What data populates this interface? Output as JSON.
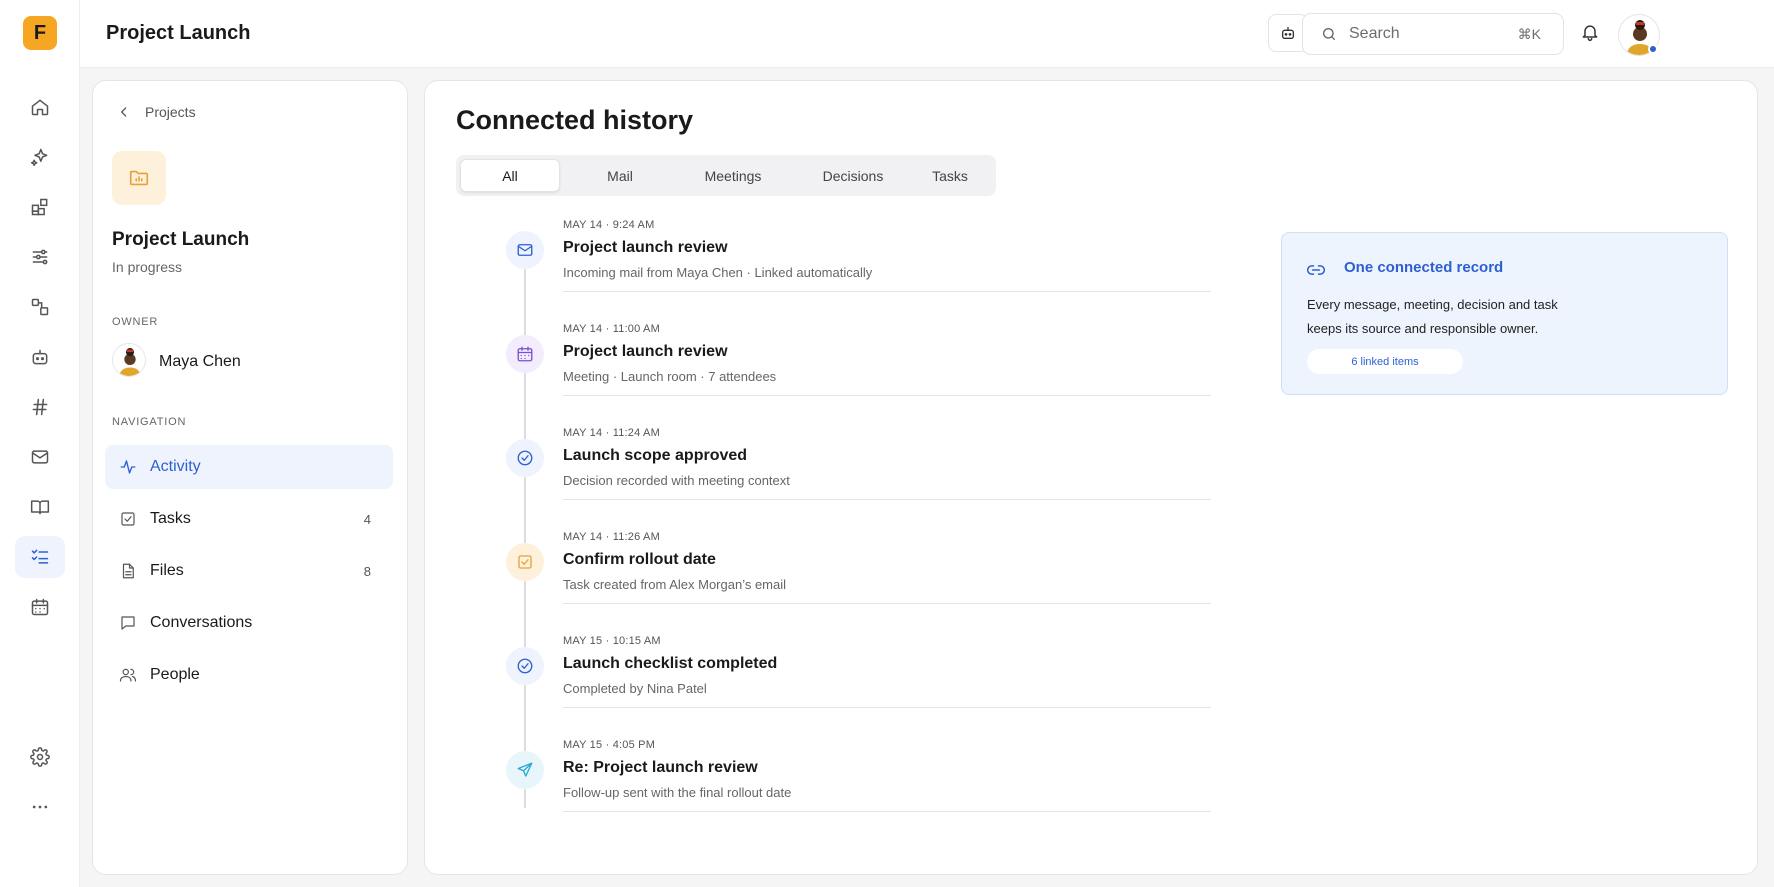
{
  "app": {
    "logo_letter": "F",
    "accent": "#2d5fd3",
    "brand": "#f5a623"
  },
  "topbar": {
    "title": "Project Launch",
    "search_placeholder": "Search",
    "search_shortcut": "⌘K"
  },
  "rail": {
    "icons": [
      "home-icon",
      "sparkle-icon",
      "apps-icon",
      "sliders-icon",
      "shapes-icon",
      "bot-icon",
      "hash-icon",
      "mail-icon",
      "book-icon",
      "checklist-icon",
      "calendar-icon",
      "gear-icon",
      "more-icon"
    ],
    "active": "checklist-icon"
  },
  "left": {
    "back_label": "Projects",
    "project_title": "Project Launch",
    "project_status": "In progress",
    "owner_heading": "OWNER",
    "owner_name": "Maya Chen",
    "nav_heading": "NAVIGATION",
    "nav": [
      {
        "label": "Activity",
        "count": "",
        "icon": "activity-icon",
        "active": true
      },
      {
        "label": "Tasks",
        "count": "4",
        "icon": "task-icon"
      },
      {
        "label": "Files",
        "count": "8",
        "icon": "file-icon"
      },
      {
        "label": "Conversations",
        "count": "",
        "icon": "chat-icon"
      },
      {
        "label": "People",
        "count": "",
        "icon": "people-icon"
      }
    ]
  },
  "main": {
    "title": "Connected history",
    "tabs": [
      "All",
      "Mail",
      "Meetings",
      "Decisions",
      "Tasks"
    ],
    "active_tab": "All",
    "events": [
      {
        "time": "MAY 14 · 9:24 AM",
        "title": "Project launch review",
        "sub": "Incoming mail from Maya Chen · Linked automatically",
        "icon": "mail-icon",
        "color": "#2d5fd3"
      },
      {
        "time": "MAY 14 · 11:00 AM",
        "title": "Project launch review",
        "sub": "Meeting · Launch room · 7 attendees",
        "icon": "calendar-icon",
        "color": "#7b4fd4"
      },
      {
        "time": "MAY 14 · 11:24 AM",
        "title": "Launch scope approved",
        "sub": "Decision recorded with meeting context",
        "icon": "check-circle-icon",
        "color": "#2d5fd3"
      },
      {
        "time": "MAY 14 · 11:26 AM",
        "title": "Confirm rollout date",
        "sub": "Task created from Alex Morgan’s email",
        "icon": "task-icon",
        "color": "#e8a13a"
      },
      {
        "time": "MAY 15 · 10:15 AM",
        "title": "Launch checklist completed",
        "sub": "Completed by Nina Patel",
        "icon": "check-circle-icon",
        "color": "#2d5fd3"
      },
      {
        "time": "MAY 15 · 4:05 PM",
        "title": "Re: Project launch review",
        "sub": "Follow-up sent with the final rollout date",
        "icon": "send-icon",
        "color": "#2aa8d8"
      }
    ],
    "card": {
      "title": "One connected record",
      "body": "Every message, meeting, decision and task keeps its source and responsible owner.",
      "pill": "6 linked items"
    }
  }
}
